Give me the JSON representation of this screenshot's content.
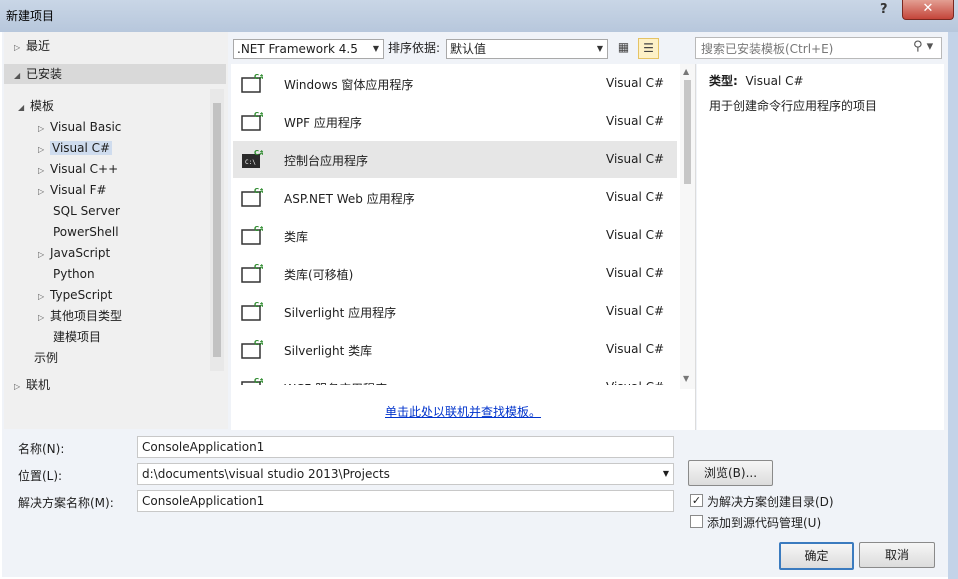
{
  "window": {
    "title": "新建项目",
    "help": "?",
    "close": "✕"
  },
  "tree": {
    "recent": "最近",
    "installed": "已安装",
    "templates": "模板",
    "items": [
      "Visual Basic",
      "Visual C#",
      "Visual C++",
      "Visual F#",
      "SQL Server",
      "PowerShell",
      "JavaScript",
      "Python",
      "TypeScript",
      "其他项目类型",
      "建模项目"
    ],
    "samples": "示例",
    "online": "联机"
  },
  "toolbar": {
    "framework": ".NET Framework 4.5",
    "sort_label": "排序依据:",
    "sort_value": "默认值",
    "search_placeholder": "搜索已安装模板(Ctrl+E)",
    "search_icon": "search-icon"
  },
  "templates": [
    {
      "name": "Windows 窗体应用程序",
      "lang": "Visual C#"
    },
    {
      "name": "WPF 应用程序",
      "lang": "Visual C#"
    },
    {
      "name": "控制台应用程序",
      "lang": "Visual C#"
    },
    {
      "name": "ASP.NET Web 应用程序",
      "lang": "Visual C#"
    },
    {
      "name": "类库",
      "lang": "Visual C#"
    },
    {
      "name": "类库(可移植)",
      "lang": "Visual C#"
    },
    {
      "name": "Silverlight 应用程序",
      "lang": "Visual C#"
    },
    {
      "name": "Silverlight 类库",
      "lang": "Visual C#"
    },
    {
      "name": "WCF 服务应用程序",
      "lang": "Visual C#"
    }
  ],
  "online_link": "单击此处以联机并查找模板。",
  "details": {
    "type_label": "类型:",
    "type_value": "Visual C#",
    "description": "用于创建命令行应用程序的项目"
  },
  "form": {
    "name_label": "名称(N):",
    "name_value": "ConsoleApplication1",
    "location_label": "位置(L):",
    "location_value": "d:\\documents\\visual studio 2013\\Projects",
    "browse_label": "浏览(B)...",
    "solution_label": "解决方案名称(M):",
    "solution_value": "ConsoleApplication1",
    "create_dir_label": "为解决方案创建目录(D)",
    "create_dir_checked": true,
    "add_sc_label": "添加到源代码管理(U)",
    "add_sc_checked": false,
    "ok_label": "确定",
    "cancel_label": "取消"
  },
  "colors": {
    "accent": "#3b7bbf",
    "link": "#0033cc",
    "lang_badge": "#2e8b2e"
  }
}
